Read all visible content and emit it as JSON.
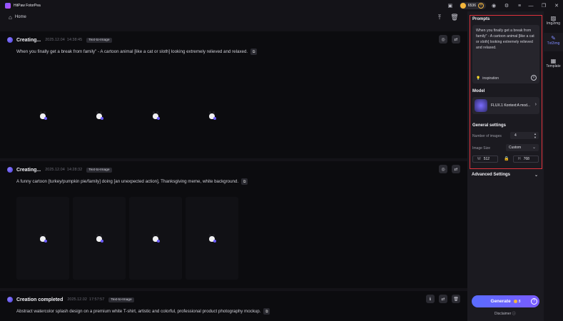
{
  "window": {
    "app_name": "HitPaw FotorPea",
    "coins": "6536"
  },
  "nav": {
    "home_label": "Home"
  },
  "feed": {
    "cards": [
      {
        "title": "Creating...",
        "date": "2025.12.04",
        "time": "14:38:45",
        "chip": "Text-to-Image",
        "prompt": "When you finally get a break from family\" - A cartoon animal [like a cat or sloth] looking extremely relieved and relaxed."
      },
      {
        "title": "Creating...",
        "date": "2025.12.04",
        "time": "14:28:32",
        "chip": "Text-to-Image",
        "prompt": "A funny cartoon [turkey/pumpkin pie/family] doing [an unexpected action], Thanksgiving meme, white background."
      },
      {
        "title": "Creation completed",
        "date": "2025.12.02",
        "time": "17:57:57",
        "chip": "Text-to-Image",
        "prompt": "Abstract watercolor splash design on a premium white T-shirt, artistic and colorful, professional product photography mockup."
      }
    ]
  },
  "settings": {
    "prompts_title": "Prompts",
    "prompt_value": "When you finally get a break from family\" - A cartoon animal [like a cat or sloth] looking extremely relieved and relaxed.",
    "inspiration_label": "inspiration",
    "model_title": "Model",
    "model_name": "FLUX.1 Kontext:A mod...",
    "general_title": "General settings",
    "num_images_label": "Number of images",
    "num_images_value": "4",
    "image_size_label": "Image Size",
    "image_size_value": "Custom",
    "width_key": "W",
    "width_value": "512",
    "height_key": "H",
    "height_value": "768",
    "advanced_label": "Advanced Settings",
    "generate_label": "Generate",
    "generate_cost": "8",
    "disclaimer_label": "Disclaimer"
  },
  "rail": {
    "items": [
      {
        "label": "Img2img",
        "icon": "image-icon"
      },
      {
        "label": "Txt2img",
        "icon": "text-image-icon"
      },
      {
        "label": "Template",
        "icon": "template-grid-icon"
      }
    ]
  },
  "colors": {
    "accent": "#6c7bff",
    "highlight_border": "#e0323c",
    "coin": "#f3b53b"
  }
}
